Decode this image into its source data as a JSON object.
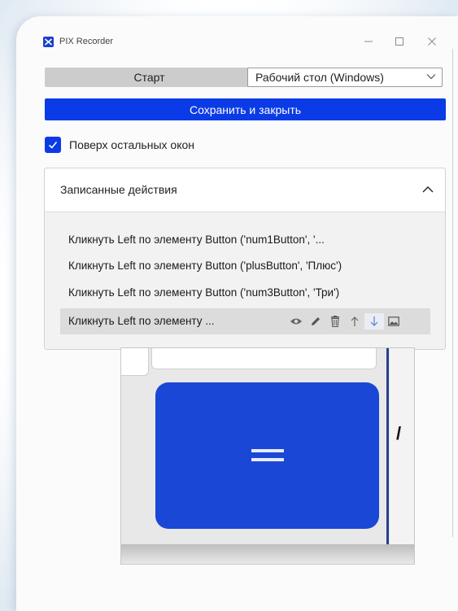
{
  "window": {
    "title": "PIX Recorder",
    "controls": [
      "minimize",
      "maximize",
      "close"
    ]
  },
  "toolbar": {
    "start_label": "Старт",
    "source_selected": "Рабочий стол (Windows)",
    "save_close_label": "Сохранить и закрыть"
  },
  "options": {
    "always_on_top_label": "Поверх остальных окон",
    "always_on_top_checked": true
  },
  "recorded": {
    "title": "Записанные действия",
    "items": [
      {
        "label": "Кликнуть Left по элементу Button ('num1Button', '..."
      },
      {
        "label": "Кликнуть Left по элементу Button ('plusButton', 'Плюс')"
      },
      {
        "label": "Кликнуть Left по элементу Button ('num3Button', 'Три')"
      },
      {
        "label": "Кликнуть Left по элементу ...",
        "selected": true
      }
    ],
    "row_tools": [
      "eye-icon",
      "pencil-icon",
      "trash-icon",
      "arrow-up-icon",
      "arrow-down-icon",
      "image-icon"
    ]
  },
  "preview": {
    "key_symbol": "=",
    "peek_char": "/"
  },
  "colors": {
    "accent": "#0b3be6",
    "start_button": "#cccccc",
    "equals_key": "#1b47d6"
  }
}
